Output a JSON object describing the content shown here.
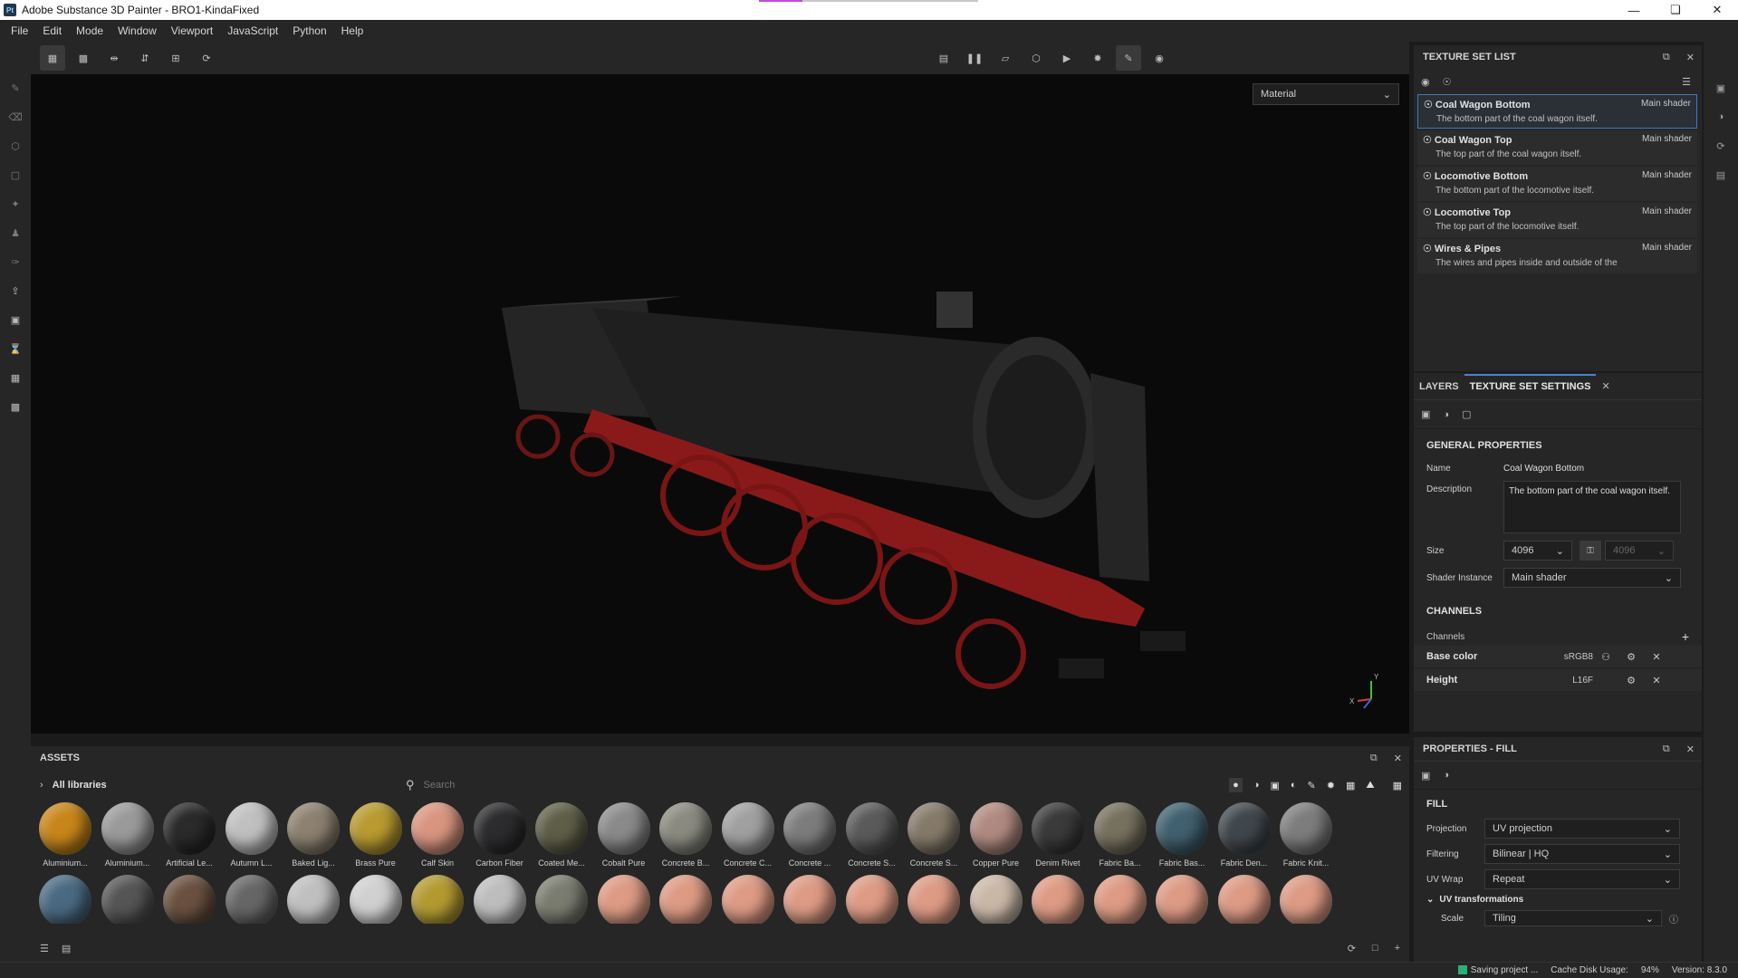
{
  "window": {
    "title": "Adobe Substance 3D Painter - BRO1-KindaFixed",
    "logo": "Pt",
    "save_progress": 0.2
  },
  "menu": [
    "File",
    "Edit",
    "Mode",
    "Window",
    "Viewport",
    "JavaScript",
    "Python",
    "Help"
  ],
  "viewport": {
    "material_mode": "Material",
    "axis_y": "Y",
    "axis_x": "X"
  },
  "texture_set_list": {
    "title": "TEXTURE SET LIST",
    "items": [
      {
        "name": "Coal Wagon Bottom",
        "shader": "Main shader",
        "desc": "The bottom part of the coal wagon itself."
      },
      {
        "name": "Coal Wagon Top",
        "shader": "Main shader",
        "desc": "The top part of the coal wagon itself."
      },
      {
        "name": "Locomotive Bottom",
        "shader": "Main shader",
        "desc": "The bottom part of the locomotive itself."
      },
      {
        "name": "Locomotive Top",
        "shader": "Main shader",
        "desc": "The top part of the locomotive itself."
      },
      {
        "name": "Wires & Pipes",
        "shader": "Main shader",
        "desc": "The wires and pipes inside and outside of the"
      }
    ]
  },
  "tss": {
    "tab_layers": "LAYERS",
    "tab_settings": "TEXTURE SET SETTINGS",
    "general": "GENERAL PROPERTIES",
    "name_label": "Name",
    "name_value": "Coal Wagon Bottom",
    "desc_label": "Description",
    "desc_value": "The bottom part of the coal wagon itself.",
    "size_label": "Size",
    "size_value": "4096",
    "size_value2": "4096",
    "shader_label": "Shader Instance",
    "shader_value": "Main shader",
    "channels_section": "CHANNELS",
    "channels_label": "Channels",
    "channels": [
      {
        "name": "Base color",
        "format": "sRGB8"
      },
      {
        "name": "Height",
        "format": "L16F"
      }
    ]
  },
  "properties": {
    "title": "PROPERTIES - FILL",
    "fill": "FILL",
    "projection_label": "Projection",
    "projection_value": "UV projection",
    "filtering_label": "Filtering",
    "filtering_value": "Bilinear | HQ",
    "uvwrap_label": "UV Wrap",
    "uvwrap_value": "Repeat",
    "uvtrans": "UV transformations",
    "scale_label": "Scale",
    "scale_value": "Tiling"
  },
  "assets": {
    "title": "ASSETS",
    "library": "All libraries",
    "search_placeholder": "Search",
    "row1": [
      {
        "name": "Aluminium...",
        "color": "#c8861a"
      },
      {
        "name": "Aluminium...",
        "color": "#9a9a9a"
      },
      {
        "name": "Artificial Le...",
        "color": "#2a2a2a"
      },
      {
        "name": "Autumn L...",
        "color": "#c0c0c0"
      },
      {
        "name": "Baked Lig...",
        "color": "#8c8070"
      },
      {
        "name": "Brass Pure",
        "color": "#b89a30"
      },
      {
        "name": "Calf Skin",
        "color": "#d99580"
      },
      {
        "name": "Carbon Fiber",
        "color": "#2c2c2e"
      },
      {
        "name": "Coated Me...",
        "color": "#5f5f48"
      },
      {
        "name": "Cobalt Pure",
        "color": "#8a8a8a"
      },
      {
        "name": "Concrete B...",
        "color": "#8a8a80"
      },
      {
        "name": "Concrete C...",
        "color": "#a0a0a0"
      },
      {
        "name": "Concrete ...",
        "color": "#7c7c7c"
      },
      {
        "name": "Concrete S...",
        "color": "#5a5a5a"
      },
      {
        "name": "Concrete S...",
        "color": "#857a6a"
      },
      {
        "name": "Copper Pure",
        "color": "#b08a80"
      },
      {
        "name": "Denim Rivet",
        "color": "#3a3a3a"
      },
      {
        "name": "Fabric Ba...",
        "color": "#76705e"
      },
      {
        "name": "Fabric Bas...",
        "color": "#41606f"
      },
      {
        "name": "Fabric Den...",
        "color": "#40474c"
      },
      {
        "name": "Fabric Knit...",
        "color": "#7d7d7d"
      }
    ],
    "row2_colors": [
      "#4a6a82",
      "#555555",
      "#6a5040",
      "#666666",
      "#bfbfbf",
      "#d0d0d0",
      "#b39a30",
      "#bdbdbd",
      "#7a7c70",
      "#dd9a84",
      "#dd9a84",
      "#dd9a84",
      "#dd9a84",
      "#dd9a84",
      "#dd9a84",
      "#c9b8a8",
      "#dd9a84",
      "#dd9a84",
      "#dd9a84",
      "#dd9a84",
      "#dd9a84"
    ]
  },
  "status": {
    "saving": "Saving project ...",
    "cache": "Cache Disk Usage:",
    "cache_value": "94%",
    "version": "Version: 8.3.0"
  }
}
